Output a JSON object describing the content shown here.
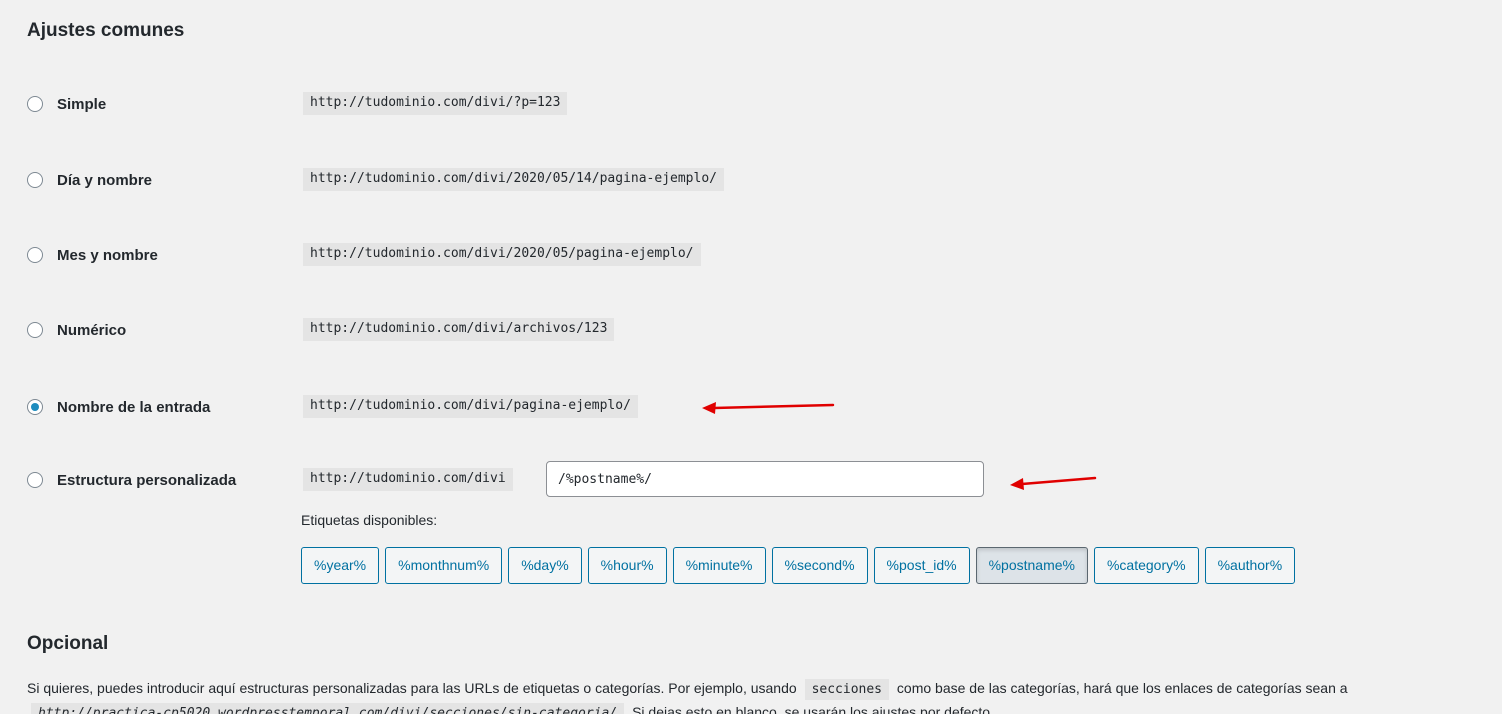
{
  "sections": {
    "common_title": "Ajustes comunes",
    "optional_title": "Opcional"
  },
  "options": [
    {
      "label": "Simple",
      "example": "http://tudominio.com/divi/?p=123",
      "checked": false
    },
    {
      "label": "Día y nombre",
      "example": "http://tudominio.com/divi/2020/05/14/pagina-ejemplo/",
      "checked": false
    },
    {
      "label": "Mes y nombre",
      "example": "http://tudominio.com/divi/2020/05/pagina-ejemplo/",
      "checked": false
    },
    {
      "label": "Numérico",
      "example": "http://tudominio.com/divi/archivos/123",
      "checked": false
    },
    {
      "label": "Nombre de la entrada",
      "example": "http://tudominio.com/divi/pagina-ejemplo/",
      "checked": true
    },
    {
      "label": "Estructura personalizada",
      "example": "http://tudominio.com/divi",
      "checked": false
    }
  ],
  "custom_structure": {
    "value": "/%postname%/"
  },
  "available_tags": {
    "label": "Etiquetas disponibles:",
    "tags": [
      "%year%",
      "%monthnum%",
      "%day%",
      "%hour%",
      "%minute%",
      "%second%",
      "%post_id%",
      "%postname%",
      "%category%",
      "%author%"
    ],
    "active": "%postname%"
  },
  "optional": {
    "description_before": "Si quieres, puedes introducir aquí estructuras personalizadas para las URLs de etiquetas o categorías. Por ejemplo, usando",
    "inline_code": "secciones",
    "description_after": "como base de las categorías, hará que los enlaces de categorías sean a",
    "line2_code": "http://practica-cp5020.wordpresstemporal.com/divi/secciones/sin-categoria/",
    "line2_after": "Si dejas esto en blanco, se usarán los ajustes por defecto."
  },
  "colors": {
    "accent": "#0071a1",
    "radio_checked": "#1e8cbe",
    "annotation_arrow": "#e00000"
  },
  "icons": {
    "annotation": "red-arrow-icon"
  }
}
